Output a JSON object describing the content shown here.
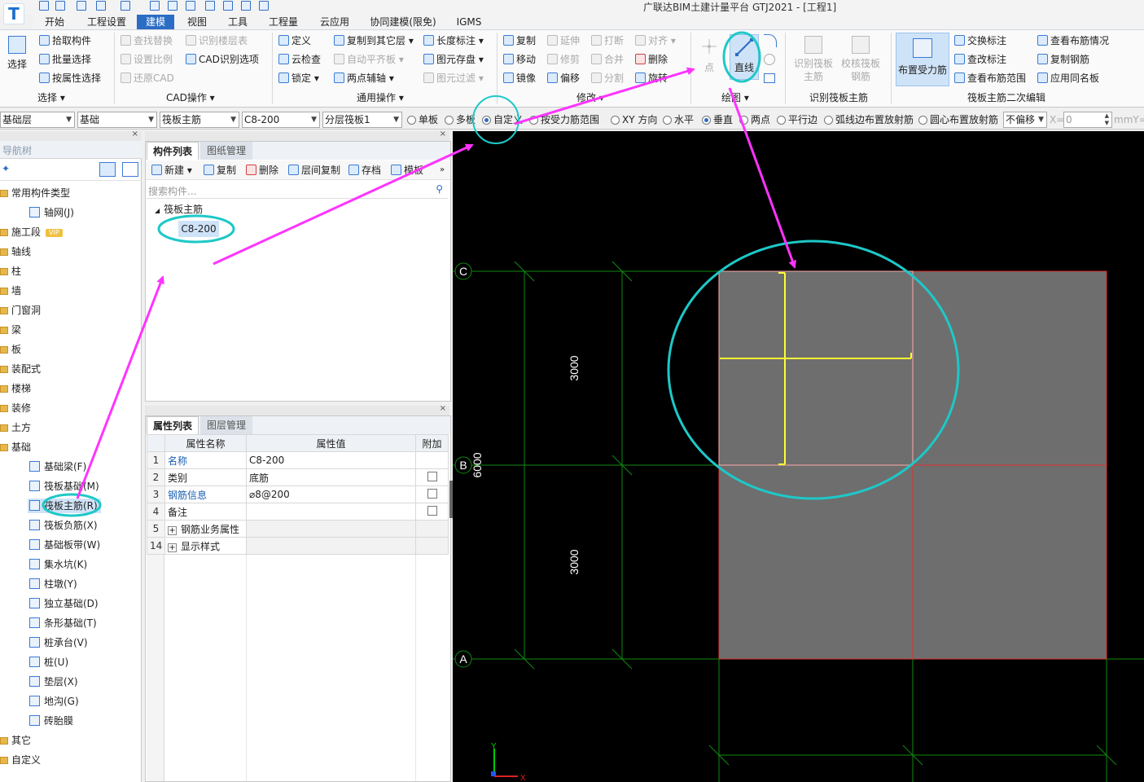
{
  "window": {
    "title": "广联达BIM土建计量平台 GTJ2021 - [工程1]",
    "logo": "T"
  },
  "menu": [
    "开始",
    "工程设置",
    "建模",
    "视图",
    "工具",
    "工程量",
    "云应用",
    "协同建模(限免)",
    "IGMS"
  ],
  "menu_active": "建模",
  "ribbon": {
    "select": {
      "big": "选择",
      "items": [
        "拾取构件",
        "批量选择",
        "按属性选择"
      ],
      "label": "选择 ▾"
    },
    "cad": {
      "items": [
        "查找替换",
        "设置比例",
        "还原CAD",
        "识别楼层表",
        "CAD识别选项"
      ],
      "label": "CAD操作 ▾"
    },
    "general": {
      "items": [
        "定义",
        "云检查",
        "锁定 ▾",
        "复制到其它层 ▾",
        "自动平齐板 ▾",
        "两点辅轴 ▾",
        "长度标注 ▾",
        "图元存盘 ▾",
        "图元过滤 ▾"
      ],
      "label": "通用操作 ▾"
    },
    "modify": {
      "items": [
        "复制",
        "移动",
        "镜像",
        "延伸",
        "修剪",
        "偏移",
        "打断",
        "合并",
        "分割",
        "对齐 ▾",
        "删除",
        "旋转"
      ],
      "label": "修改 ▾"
    },
    "draw": {
      "items": [
        "点",
        "直线"
      ],
      "label": "绘图 ▾"
    },
    "recognize": {
      "items": [
        "识别筏板主筋",
        "校核筏板钢筋"
      ],
      "label": "识别筏板主筋"
    },
    "edit2": {
      "big": "布置受力筋",
      "items": [
        "交换标注",
        "查改标注",
        "查看布筋范围",
        "查看布筋情况",
        "复制钢筋",
        "应用同名板"
      ],
      "label": "筏板主筋二次编辑"
    }
  },
  "toolbar": {
    "combos": [
      "基础层",
      "基础",
      "筏板主筋",
      "C8-200",
      "分层筏板1"
    ],
    "radios": [
      "单板",
      "多板",
      "自定义",
      "按受力筋范围",
      "XY 方向",
      "水平",
      "垂直",
      "两点",
      "平行边",
      "弧线边布置放射筋",
      "圆心布置放射筋"
    ],
    "radio_selected": [
      "自定义",
      "垂直"
    ],
    "offset": "不偏移",
    "x_label": "X=",
    "x_value": "0",
    "unit": "mmY="
  },
  "nav": {
    "title": "导航树",
    "items": [
      {
        "label": "常用构件类型",
        "type": "folder"
      },
      {
        "label": "轴网(J)",
        "type": "child"
      },
      {
        "label": "施工段",
        "type": "folder",
        "badge": "VIP"
      },
      {
        "label": "轴线",
        "type": "folder"
      },
      {
        "label": "柱",
        "type": "folder"
      },
      {
        "label": "墙",
        "type": "folder"
      },
      {
        "label": "门窗洞",
        "type": "folder"
      },
      {
        "label": "梁",
        "type": "folder"
      },
      {
        "label": "板",
        "type": "folder"
      },
      {
        "label": "装配式",
        "type": "folder"
      },
      {
        "label": "楼梯",
        "type": "folder"
      },
      {
        "label": "装修",
        "type": "folder"
      },
      {
        "label": "土方",
        "type": "folder"
      },
      {
        "label": "基础",
        "type": "folder"
      },
      {
        "label": "基础梁(F)",
        "type": "child"
      },
      {
        "label": "筏板基础(M)",
        "type": "child"
      },
      {
        "label": "筏板主筋(R)",
        "type": "child",
        "selected": true
      },
      {
        "label": "筏板负筋(X)",
        "type": "child"
      },
      {
        "label": "基础板带(W)",
        "type": "child"
      },
      {
        "label": "集水坑(K)",
        "type": "child"
      },
      {
        "label": "柱墩(Y)",
        "type": "child"
      },
      {
        "label": "独立基础(D)",
        "type": "child"
      },
      {
        "label": "条形基础(T)",
        "type": "child"
      },
      {
        "label": "桩承台(V)",
        "type": "child"
      },
      {
        "label": "桩(U)",
        "type": "child"
      },
      {
        "label": "垫层(X)",
        "type": "child"
      },
      {
        "label": "地沟(G)",
        "type": "child"
      },
      {
        "label": "砖胎膜",
        "type": "child"
      },
      {
        "label": "其它",
        "type": "folder"
      },
      {
        "label": "自定义",
        "type": "folder"
      }
    ]
  },
  "components": {
    "tabs": [
      "构件列表",
      "图纸管理"
    ],
    "tools": [
      "新建 ▾",
      "复制",
      "删除",
      "层间复制",
      "存档",
      "模板"
    ],
    "search_placeholder": "搜索构件...",
    "group": "筏板主筋",
    "item": "C8-200"
  },
  "properties": {
    "tabs": [
      "属性列表",
      "图层管理"
    ],
    "headers": [
      "属性名称",
      "属性值",
      "附加"
    ],
    "rows": [
      {
        "n": "1",
        "name": "名称",
        "value": "C8-200",
        "extra": "",
        "blue": true
      },
      {
        "n": "2",
        "name": "类别",
        "value": "底筋",
        "extra": "chk",
        "blue": false
      },
      {
        "n": "3",
        "name": "钢筋信息",
        "value": "⌀8@200",
        "extra": "chk",
        "blue": true
      },
      {
        "n": "4",
        "name": "备注",
        "value": "",
        "extra": "chk",
        "blue": false
      },
      {
        "n": "5",
        "name": "钢筋业务属性",
        "value": "",
        "extra": "",
        "blue": false,
        "expand": true
      },
      {
        "n": "14",
        "name": "显示样式",
        "value": "",
        "extra": "",
        "blue": false,
        "expand": true
      }
    ]
  },
  "canvas": {
    "axes": [
      "C",
      "B",
      "A"
    ],
    "dims": [
      "3000",
      "6000",
      "3000"
    ],
    "ucs_x": "X",
    "ucs_y": "Y",
    "colors": {
      "bg": "#000000",
      "grid": "#0f8a0f",
      "slab": "#6e6e6e",
      "slab_edge": "#e03030",
      "rebar": "#ffff33",
      "annot_circle": "#1ec8c8",
      "annot_arrow": "#ff33ff"
    }
  }
}
